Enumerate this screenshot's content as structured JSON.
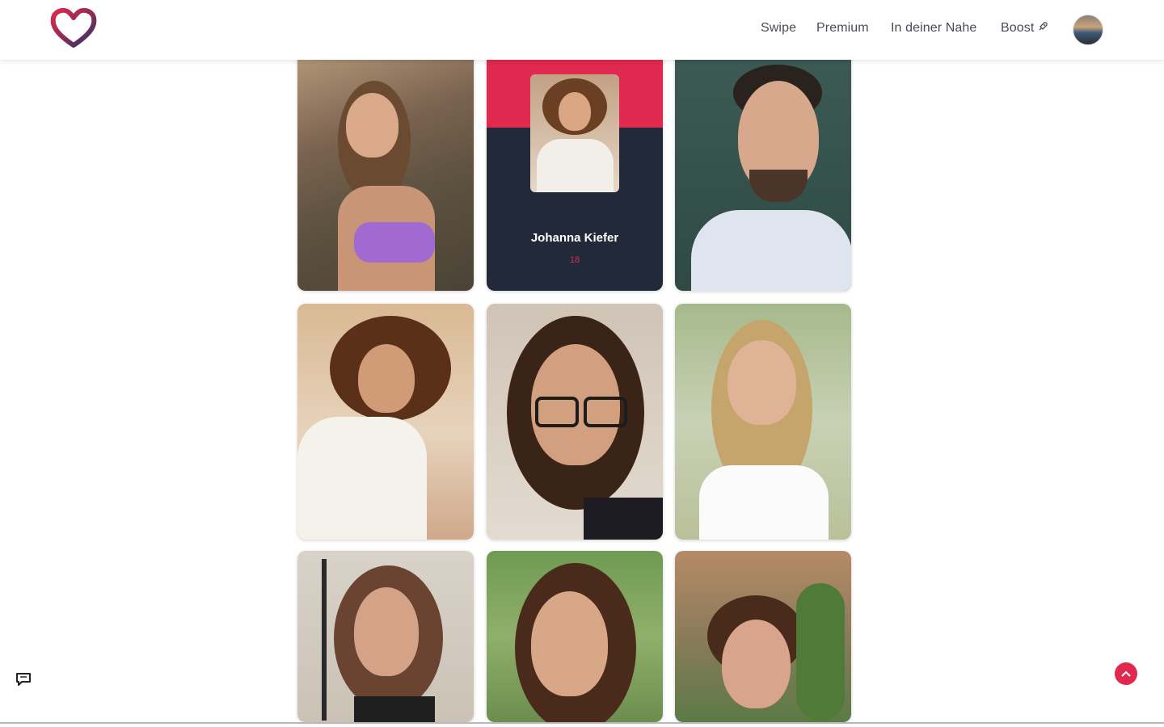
{
  "header": {
    "logo": "heart-logo",
    "nav": {
      "swipe": "Swipe",
      "premium": "Premium",
      "near": "In deiner Nahe",
      "boost": "Boost"
    },
    "boost_icon": "rocket-icon",
    "avatar": "user-avatar"
  },
  "grid": {
    "cards": [
      {
        "type": "photo"
      },
      {
        "type": "profile",
        "name": "Johanna Kiefer",
        "age": "18"
      },
      {
        "type": "photo"
      },
      {
        "type": "photo"
      },
      {
        "type": "photo"
      },
      {
        "type": "photo"
      },
      {
        "type": "photo"
      },
      {
        "type": "photo"
      },
      {
        "type": "photo"
      }
    ]
  },
  "floating": {
    "scroll_top_icon": "chevron-up-icon",
    "chat_icon": "chat-icon"
  },
  "colors": {
    "accent": "#e0294f",
    "dark_card": "#222a3a",
    "nav_text": "#4a4a5a"
  }
}
